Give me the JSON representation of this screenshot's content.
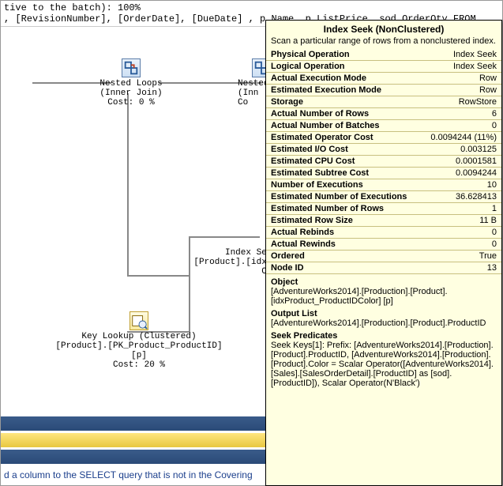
{
  "code": {
    "line1": "tive to the batch): 100%",
    "line2": ", [RevisionNumber], [OrderDate], [DueDate] , p.Name, p.ListPrice, sod.OrderQty FROM"
  },
  "plan": {
    "nested_loops": {
      "title": "Nested Loops",
      "subtitle": "(Inner Join)",
      "cost": "Cost: 0 %"
    },
    "nested_right": {
      "title": "Nested",
      "subtitle": "(Inn",
      "cost": "Co"
    },
    "index_seek": {
      "title": "Index Seek",
      "subtitle": "[Product].[idxPr",
      "cost": "Cos"
    },
    "key_lookup": {
      "title": "Key Lookup (Clustered)",
      "subtitle": "[Product].[PK_Product_ProductID] [p]",
      "cost": "Cost: 20 %"
    }
  },
  "hint": "d a column to the SELECT query that is not in the Covering",
  "tooltip": {
    "title": "Index Seek (NonClustered)",
    "desc": "Scan a particular range of rows from a nonclustered index.",
    "rows": [
      [
        "Physical Operation",
        "Index Seek"
      ],
      [
        "Logical Operation",
        "Index Seek"
      ],
      [
        "Actual Execution Mode",
        "Row"
      ],
      [
        "Estimated Execution Mode",
        "Row"
      ],
      [
        "Storage",
        "RowStore"
      ],
      [
        "Actual Number of Rows",
        "6"
      ],
      [
        "Actual Number of Batches",
        "0"
      ],
      [
        "Estimated Operator Cost",
        "0.0094244 (11%)"
      ],
      [
        "Estimated I/O Cost",
        "0.003125"
      ],
      [
        "Estimated CPU Cost",
        "0.0001581"
      ],
      [
        "Estimated Subtree Cost",
        "0.0094244"
      ],
      [
        "Number of Executions",
        "10"
      ],
      [
        "Estimated Number of Executions",
        "36.628413"
      ],
      [
        "Estimated Number of Rows",
        "1"
      ],
      [
        "Estimated Row Size",
        "11 B"
      ],
      [
        "Actual Rebinds",
        "0"
      ],
      [
        "Actual Rewinds",
        "0"
      ],
      [
        "Ordered",
        "True"
      ],
      [
        "Node ID",
        "13"
      ]
    ],
    "object_label": "Object",
    "object_body": "[AdventureWorks2014].[Production].[Product].[idxProduct_ProductIDColor] [p]",
    "output_label": "Output List",
    "output_body": "[AdventureWorks2014].[Production].[Product].ProductID",
    "seek_label": "Seek Predicates",
    "seek_body": "Seek Keys[1]: Prefix: [AdventureWorks2014].[Production].[Product].ProductID, [AdventureWorks2014].[Production].[Product].Color = Scalar Operator([AdventureWorks2014].[Sales].[SalesOrderDetail].[ProductID] as [sod].[ProductID]), Scalar Operator(N'Black')"
  }
}
